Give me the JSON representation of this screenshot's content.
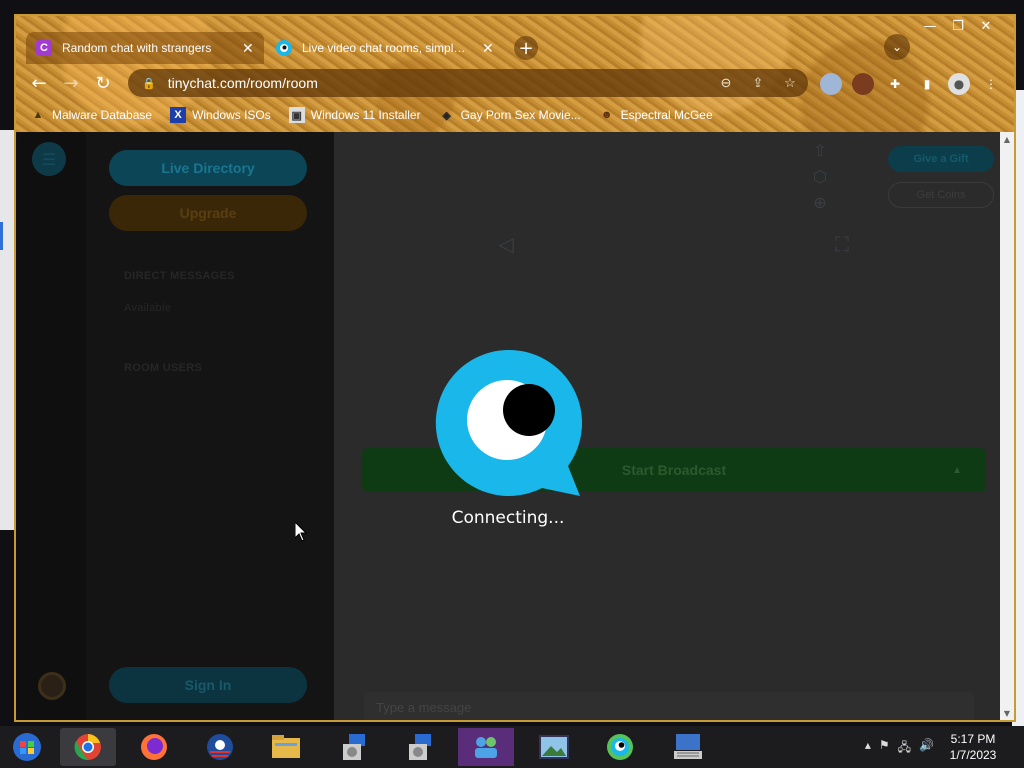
{
  "browser": {
    "tabs": [
      {
        "title": "Random chat with strangers",
        "favicon": "C",
        "active": true
      },
      {
        "title": "Live video chat rooms, simple and",
        "favicon": "tinychat-eye",
        "active": false
      }
    ],
    "new_tab": "+",
    "url": "tinychat.com/room/room",
    "bookmarks": [
      {
        "label": "Malware Database",
        "icon": "folder-icon"
      },
      {
        "label": "Windows ISOs",
        "icon": "x-icon"
      },
      {
        "label": "Windows 11 Installer",
        "icon": "installer-icon"
      },
      {
        "label": "Gay Porn Sex Movie...",
        "icon": "site-icon"
      },
      {
        "label": "Espectral McGee",
        "icon": "face-icon"
      }
    ]
  },
  "sidebar": {
    "live_directory": "Live Directory",
    "upgrade": "Upgrade",
    "direct_messages": "DIRECT MESSAGES",
    "dm_sub": "Available",
    "room_users": "ROOM USERS",
    "sign_in": "Sign In"
  },
  "main": {
    "give_gift": "Give a Gift",
    "get_coins": "Get Coins",
    "start_broadcast": "Start Broadcast",
    "message_placeholder": "Type a message"
  },
  "overlay": {
    "status": "Connecting..."
  },
  "taskbar": {
    "time": "5:17 PM",
    "date": "1/7/2023"
  },
  "colors": {
    "tinychat_blue": "#1ab7ea",
    "frame_gold": "#c79a34"
  }
}
